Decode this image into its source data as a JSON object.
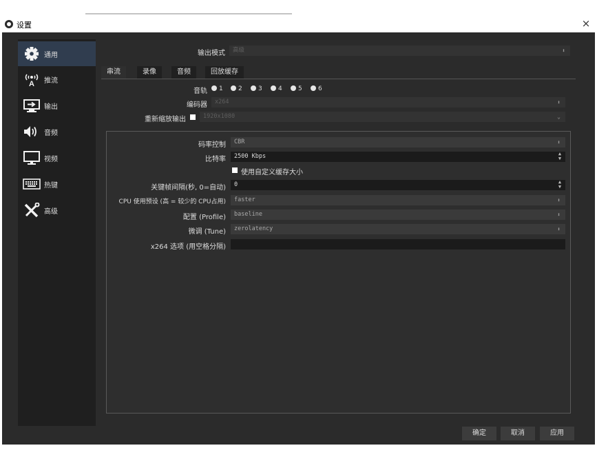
{
  "window": {
    "title": "设置",
    "close": "×"
  },
  "sidebar": {
    "items": [
      {
        "label": "通用",
        "icon": "gear-icon",
        "active": true
      },
      {
        "label": "推流",
        "icon": "broadcast-icon",
        "active": false
      },
      {
        "label": "输出",
        "icon": "output-icon",
        "active": false
      },
      {
        "label": "音频",
        "icon": "speaker-icon",
        "active": false
      },
      {
        "label": "视频",
        "icon": "monitor-icon",
        "active": false
      },
      {
        "label": "热键",
        "icon": "keyboard-icon",
        "active": false
      },
      {
        "label": "高级",
        "icon": "tools-icon",
        "active": false
      }
    ]
  },
  "output_mode": {
    "label": "输出模式",
    "value": "高级"
  },
  "tabs": [
    {
      "label": "串流",
      "active": true
    },
    {
      "label": "录像",
      "active": false
    },
    {
      "label": "音频",
      "active": false
    },
    {
      "label": "回放缓存",
      "active": false
    }
  ],
  "track": {
    "label": "音轨",
    "options": [
      "1",
      "2",
      "3",
      "4",
      "5",
      "6"
    ]
  },
  "encoder": {
    "label": "编码器",
    "value": "x264"
  },
  "rescale": {
    "label": "重新缩放输出",
    "value": "1920x1080"
  },
  "settings": {
    "rate_control": {
      "label": "码率控制",
      "value": "CBR"
    },
    "bitrate": {
      "label": "比特率",
      "value": "2500 Kbps"
    },
    "custom_buffer": {
      "label": "使用自定义缓存大小"
    },
    "keyframe": {
      "label": "关键帧间隔(秒, 0=自动)",
      "value": "0"
    },
    "cpu_preset": {
      "label": "CPU 使用预设 (高 = 较少的 CPU占用)",
      "value": "faster"
    },
    "profile": {
      "label": "配置 (Profile)",
      "value": "baseline"
    },
    "tune": {
      "label": "微调 (Tune)",
      "value": "zerolatency"
    },
    "x264_options": {
      "label": "x264 选项 (用空格分隔)",
      "value": ""
    }
  },
  "footer": {
    "ok": "确定",
    "cancel": "取消",
    "apply": "应用"
  },
  "colors": {
    "sidebar_active": "#303d4f",
    "background": "#2b2b2b",
    "sidebar": "#1f1f1f"
  }
}
